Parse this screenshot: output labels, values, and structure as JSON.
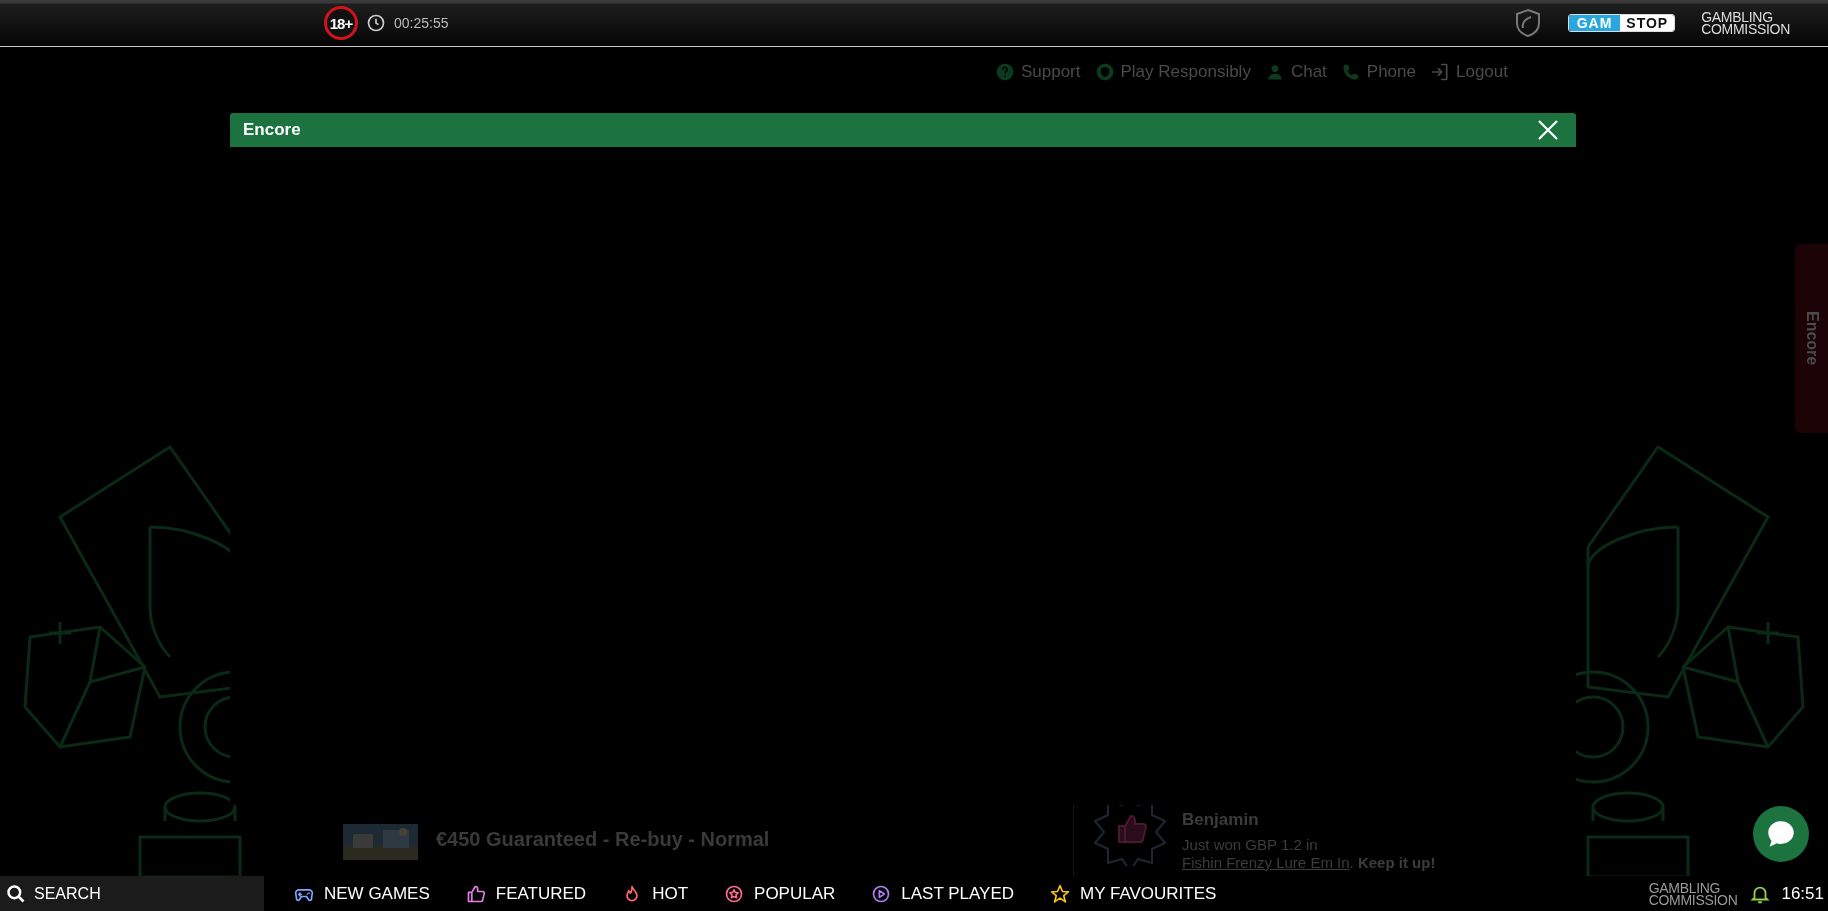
{
  "top_bar": {
    "age_badge": "18+",
    "session_time": "00:25:55",
    "gamstop": [
      "GAM",
      "STOP"
    ],
    "commission": [
      "GAMBLING",
      "COMMISSION"
    ]
  },
  "header_links": [
    {
      "label": "Support"
    },
    {
      "label": "Play Responsibly"
    },
    {
      "label": "Chat"
    },
    {
      "label": "Phone"
    },
    {
      "label": "Logout"
    }
  ],
  "modal": {
    "title": "Encore"
  },
  "side_tab": {
    "label": "Encore"
  },
  "tournaments": {
    "items": [
      {
        "title": "€450 Guaranteed - Re-buy - Normal"
      }
    ]
  },
  "winner": {
    "name": "Benjamin",
    "prefix": "Just won GBP 1.2 in ",
    "game": "Fishin Frenzy Lure Em In",
    "suffix": ". **Keep it up!**"
  },
  "bottom_nav": {
    "search": "SEARCH",
    "items": [
      {
        "label": "NEW GAMES"
      },
      {
        "label": "FEATURED"
      },
      {
        "label": "HOT"
      },
      {
        "label": "POPULAR"
      },
      {
        "label": "LAST PLAYED"
      },
      {
        "label": "MY FAVOURITES"
      }
    ],
    "commission": [
      "GAMBLING",
      "COMMISSION"
    ],
    "clock": "16:51"
  }
}
